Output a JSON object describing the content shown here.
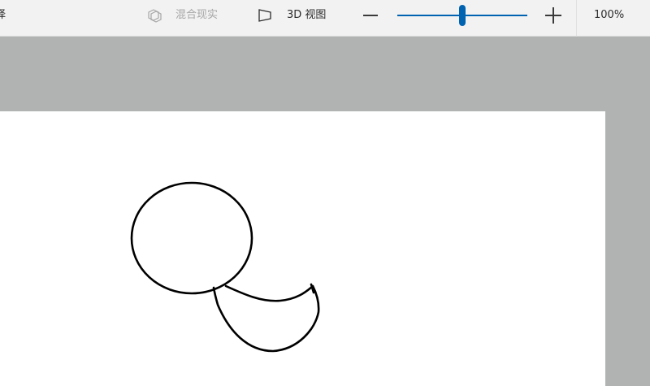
{
  "toolbar": {
    "partial_label": "择",
    "mixed_reality_label": "混合现实",
    "view_3d_label": "3D 视图",
    "zoom_percent": "100%",
    "zoom_level": 0.5
  },
  "colors": {
    "accent": "#0063b1",
    "disabled_text": "#a6a6a6",
    "workspace": "#b1b3b3",
    "canvas": "#ffffff"
  },
  "icons": {
    "mixed_reality": "mixed-reality-icon",
    "view_3d": "view-3d-icon",
    "zoom_out": "minus-icon",
    "zoom_in": "plus-icon"
  }
}
